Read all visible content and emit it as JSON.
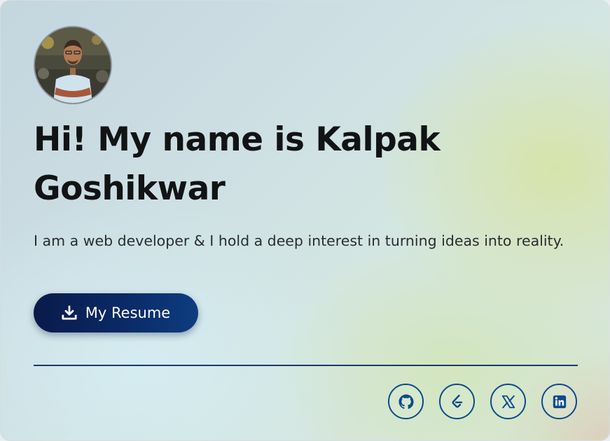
{
  "profile": {
    "avatar_icon": "profile-photo",
    "headline_line1": "Hi! My name is Kalpak",
    "headline_line2": "Goshikwar",
    "tagline": "I am a web developer & I hold a deep interest in turning ideas into reality."
  },
  "resume_button": {
    "label": "My Resume",
    "icon": "download-icon"
  },
  "socials": [
    {
      "name": "github",
      "icon": "github-icon"
    },
    {
      "name": "leetcode",
      "icon": "leetcode-icon"
    },
    {
      "name": "x",
      "icon": "x-icon"
    },
    {
      "name": "linkedin",
      "icon": "linkedin-icon"
    }
  ],
  "colors": {
    "accent": "#0c4a8c",
    "button_dark": "#0a1a4a",
    "text": "#111315"
  }
}
